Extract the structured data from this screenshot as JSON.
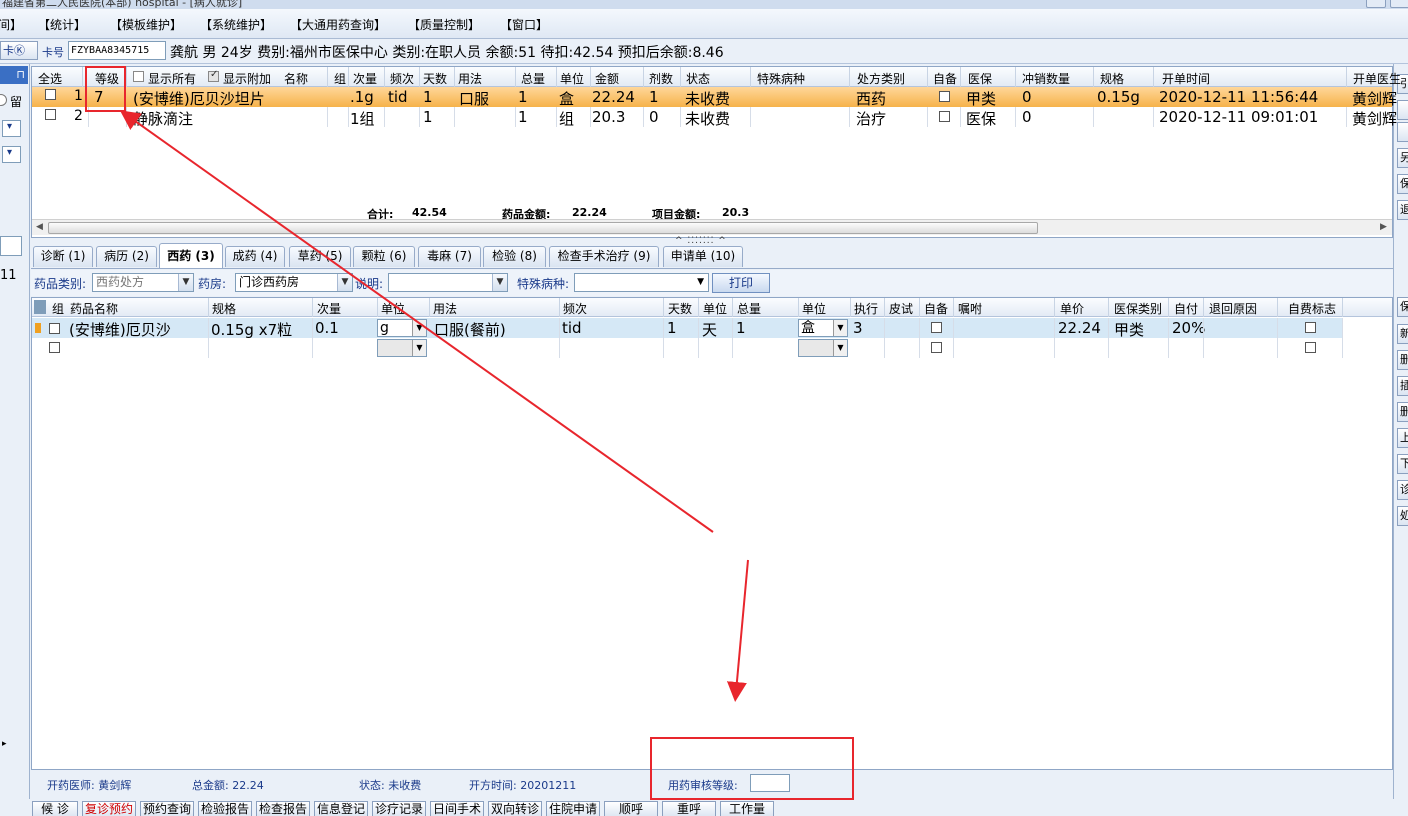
{
  "window": {
    "title": "福建省第二人民医院(本部) hospital - [病人就诊]"
  },
  "menu": [
    {
      "label": "间】"
    },
    {
      "label": "【统计】"
    },
    {
      "label": "【模板维护】"
    },
    {
      "label": "【系统维护】"
    },
    {
      "label": "【大通用药查询】"
    },
    {
      "label": "【质量控制】"
    },
    {
      "label": "【窗口】"
    }
  ],
  "patient": {
    "card_button": "卡Ⓚ",
    "card_label": "卡号",
    "card_no": "FZYBAA8345715",
    "summary": "龚航 男 24岁 费别:福州市医保中心 类别:在职人员 余额:51 待扣:42.54 预扣后余额:8.46"
  },
  "left_panel": {
    "radio_label": "留",
    "row_number": "11"
  },
  "orders": {
    "headers": {
      "select_all": "全选",
      "grade": "等级",
      "show_all": "显示所有",
      "show_attached": "显示附加",
      "name": "名称",
      "group": "组",
      "dose": "次量",
      "freq": "频次",
      "days": "天数",
      "usage": "用法",
      "qty": "总量",
      "unit": "单位",
      "amount": "金额",
      "doses": "剂数",
      "status": "状态",
      "special": "特殊病种",
      "rx_type": "处方类别",
      "self_prep": "自备",
      "insurance": "医保",
      "offset": "冲销数量",
      "spec": "规格",
      "time": "开单时间",
      "doctor": "开单医生"
    },
    "rows": [
      {
        "seq": "1",
        "grade": "7",
        "name": "(安博维)厄贝沙坦片",
        "dose": ".1g",
        "freq": "tid",
        "days": "1",
        "usage": "口服",
        "qty": "1",
        "unit": "盒",
        "amount": "22.24",
        "doses": "1",
        "status": "未收费",
        "rx_type": "西药",
        "insurance": "甲类",
        "offset": "0",
        "spec": "0.15g",
        "time": "2020-12-11 11:56:44",
        "doctor": "黄剑辉"
      },
      {
        "seq": "2",
        "grade": "",
        "name": "静脉滴注",
        "dose": "1组",
        "freq": "",
        "days": "1",
        "usage": "",
        "qty": "1",
        "unit": "组",
        "amount": "20.3",
        "doses": "0",
        "status": "未收费",
        "rx_type": "治疗",
        "insurance": "医保",
        "offset": "0",
        "spec": "",
        "time": "2020-12-11 09:01:01",
        "doctor": "黄剑辉"
      }
    ],
    "totals": {
      "total_label": "合计:",
      "total": "42.54",
      "drug_label": "药品金额:",
      "drug": "22.24",
      "item_label": "项目金额:",
      "item": "20.3"
    }
  },
  "tabs": [
    {
      "label": "诊断 (1)"
    },
    {
      "label": "病历 (2)"
    },
    {
      "label": "西药 (3)"
    },
    {
      "label": "成药 (4)"
    },
    {
      "label": "草药 (5)"
    },
    {
      "label": "颗粒 (6)"
    },
    {
      "label": "毒麻 (7)"
    },
    {
      "label": "检验 (8)"
    },
    {
      "label": "检查手术治疗 (9)"
    },
    {
      "label": "申请单 (10)"
    }
  ],
  "rx_toolbar": {
    "drug_type_label": "药品类别:",
    "drug_type_value": "西药处方",
    "pharmacy_label": "药房:",
    "pharmacy_value": "门诊西药房",
    "note_label": "说明:",
    "note_value": "",
    "special_label": "特殊病种:",
    "special_value": "",
    "print_button": "打印"
  },
  "rx_grid": {
    "headers": {
      "group": "组",
      "name": "药品名称",
      "spec": "规格",
      "dose": "次量",
      "dose_unit": "单位",
      "usage": "用法",
      "freq": "频次",
      "days": "天数",
      "day_unit": "单位",
      "qty": "总量",
      "qty_unit": "单位",
      "exec": "执行",
      "skin_test": "皮试",
      "self_prep": "自备",
      "instruction": "嘱咐",
      "price": "单价",
      "ins_type": "医保类别",
      "self_pay": "自付",
      "refund": "退回原因",
      "self_flag": "自费标志"
    },
    "rows": [
      {
        "name": "(安博维)厄贝沙",
        "spec": "0.15g x7粒",
        "dose": "0.1",
        "dose_unit": "g",
        "usage": "口服(餐前)",
        "freq": "tid",
        "days": "1",
        "day_unit": "天",
        "qty": "1",
        "qty_unit": "盒",
        "exec": "3",
        "price": "22.24",
        "ins_type": "甲类",
        "self_pay": "20%"
      },
      {
        "name": "",
        "spec": "",
        "dose": "",
        "dose_unit": "",
        "usage": "",
        "freq": "",
        "days": "",
        "day_unit": "",
        "qty": "",
        "qty_unit": "",
        "exec": "",
        "price": "",
        "ins_type": "",
        "self_pay": ""
      }
    ]
  },
  "status_bar": {
    "doctor": "开药医师: 黄剑辉",
    "total": "总金额: 22.24",
    "status": "状态: 未收费",
    "time": "开方时间: 20201211",
    "audit_label": "用药审核等级:",
    "audit_value": ""
  },
  "bottom_buttons": [
    {
      "label": "候 诊"
    },
    {
      "label": "复诊预约"
    },
    {
      "label": "预约查询"
    },
    {
      "label": "检验报告"
    },
    {
      "label": "检查报告"
    },
    {
      "label": "信息登记"
    },
    {
      "label": "诊疗记录"
    },
    {
      "label": "日间手术"
    },
    {
      "label": "双向转诊"
    },
    {
      "label": "住院申请"
    },
    {
      "label": "顺呼"
    },
    {
      "label": "重呼"
    },
    {
      "label": "工作量"
    }
  ],
  "right_panel": [
    "引",
    "",
    "",
    "另",
    "保",
    "退",
    "",
    "保",
    "新",
    "删",
    "插",
    "删",
    "上",
    "下",
    "诊",
    "処"
  ],
  "colors": {
    "selected_row": "#f6b24a",
    "rx_selected_row": "#d5e8f6",
    "annotation": "#e8262d",
    "highlight_button_text": "#d00000"
  }
}
